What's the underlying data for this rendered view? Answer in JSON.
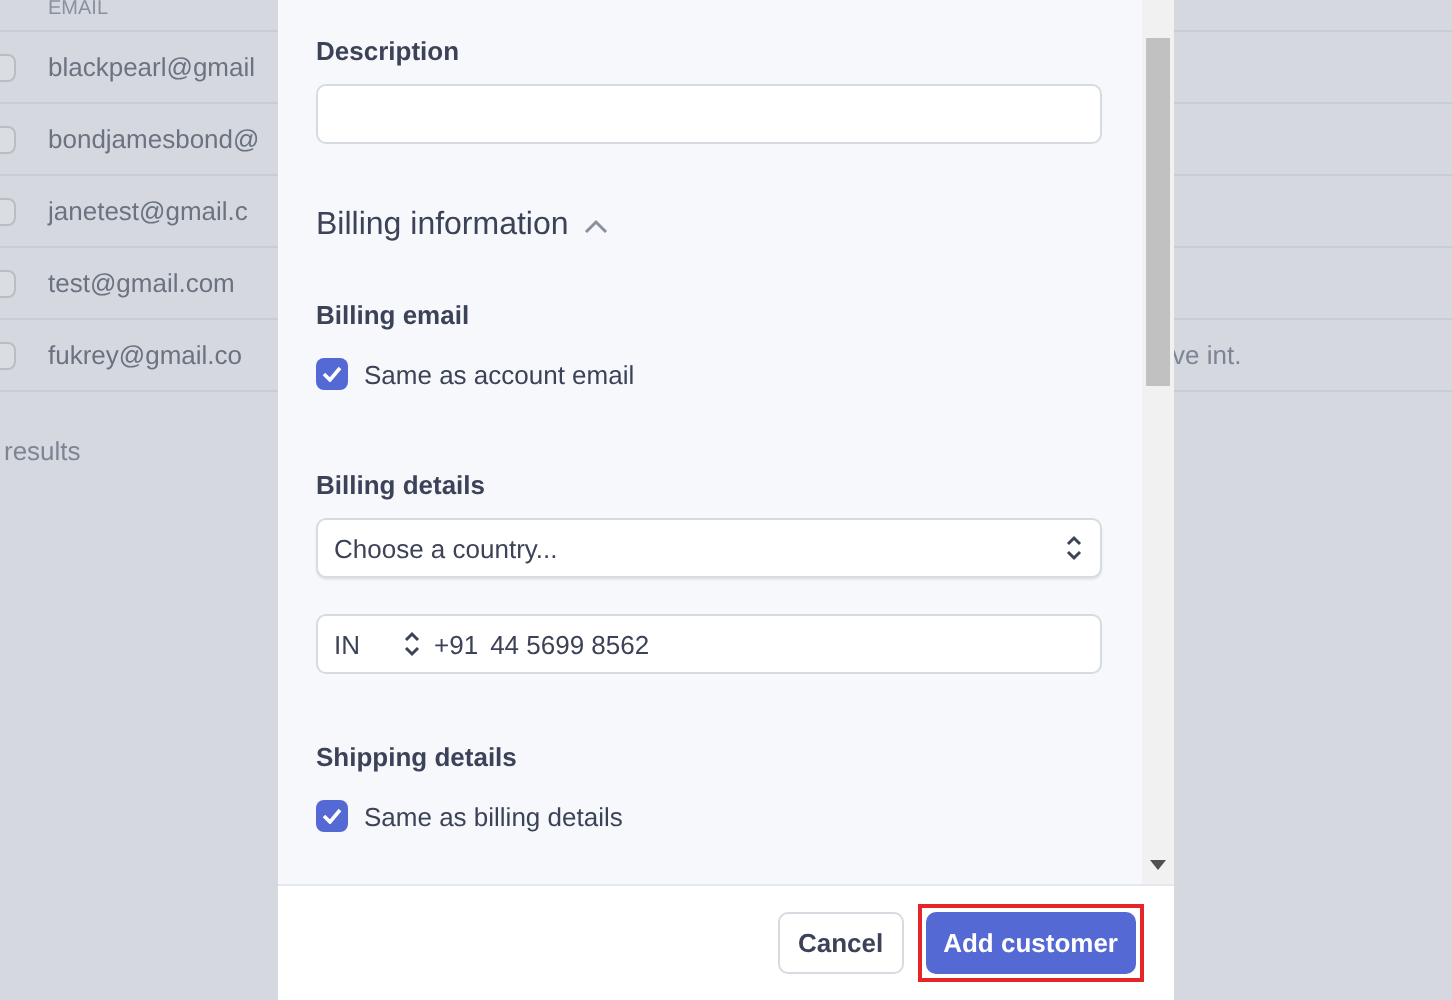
{
  "background_table": {
    "header": "EMAIL",
    "rows": [
      {
        "checked": false,
        "email": "blackpearl@gmail"
      },
      {
        "checked": false,
        "email": "bondjamesbond@"
      },
      {
        "checked": false,
        "email": "janetest@gmail.c"
      },
      {
        "checked": false,
        "email": "test@gmail.com"
      },
      {
        "checked": false,
        "email": "fukrey@gmail.co",
        "column_3": "ve int."
      }
    ],
    "footer": "results"
  },
  "modal": {
    "description": {
      "label": "Description"
    },
    "billing": {
      "title": "Billing information",
      "expanded": true,
      "billing_email": {
        "label": "Billing email",
        "checkbox": {
          "label": "Same as account email",
          "checked": true
        }
      },
      "billing_details": {
        "label": "Billing details",
        "country": {
          "value": "Choose a country..."
        },
        "phone": {
          "country_code": "IN",
          "dial_code": "+91",
          "value": "44 5699 8562"
        }
      },
      "shipping_details": {
        "label": "Shipping details",
        "checkbox": {
          "label": "Same as billing details",
          "checked": true
        }
      }
    },
    "buttons": [
      {
        "label": "Cancel",
        "kind": "secondary"
      },
      {
        "label": "Add customer",
        "kind": "primary",
        "highlighted": true
      }
    ]
  }
}
